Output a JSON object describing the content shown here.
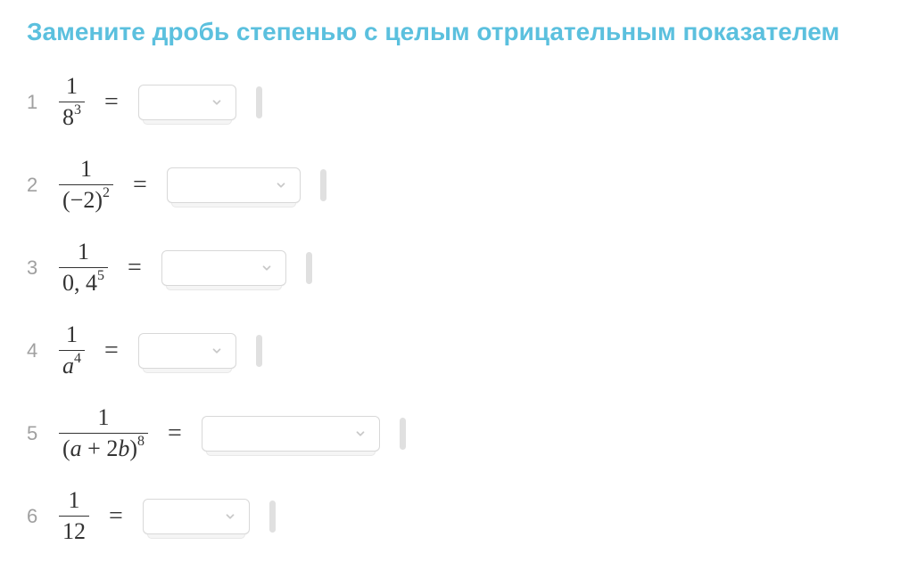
{
  "title": "Замените дробь степенью с целым отрицательным показателем",
  "problems": [
    {
      "number": "1",
      "numerator": "1",
      "denominator_base": "8",
      "denominator_exp": "3"
    },
    {
      "number": "2",
      "numerator": "1",
      "denominator_base": "(−2)",
      "denominator_exp": "2"
    },
    {
      "number": "3",
      "numerator": "1",
      "denominator_base": "0, 4",
      "denominator_exp": "5"
    },
    {
      "number": "4",
      "numerator": "1",
      "denominator_base_italic": "a",
      "denominator_exp": "4"
    },
    {
      "number": "5",
      "numerator": "1",
      "denominator_plain": "(",
      "denominator_var1": "a",
      "denominator_mid": " + 2",
      "denominator_var2": "b",
      "denominator_close": ")",
      "denominator_exp": "8"
    },
    {
      "number": "6",
      "numerator": "1",
      "denominator_base": "12",
      "denominator_exp": ""
    }
  ],
  "equals": "="
}
